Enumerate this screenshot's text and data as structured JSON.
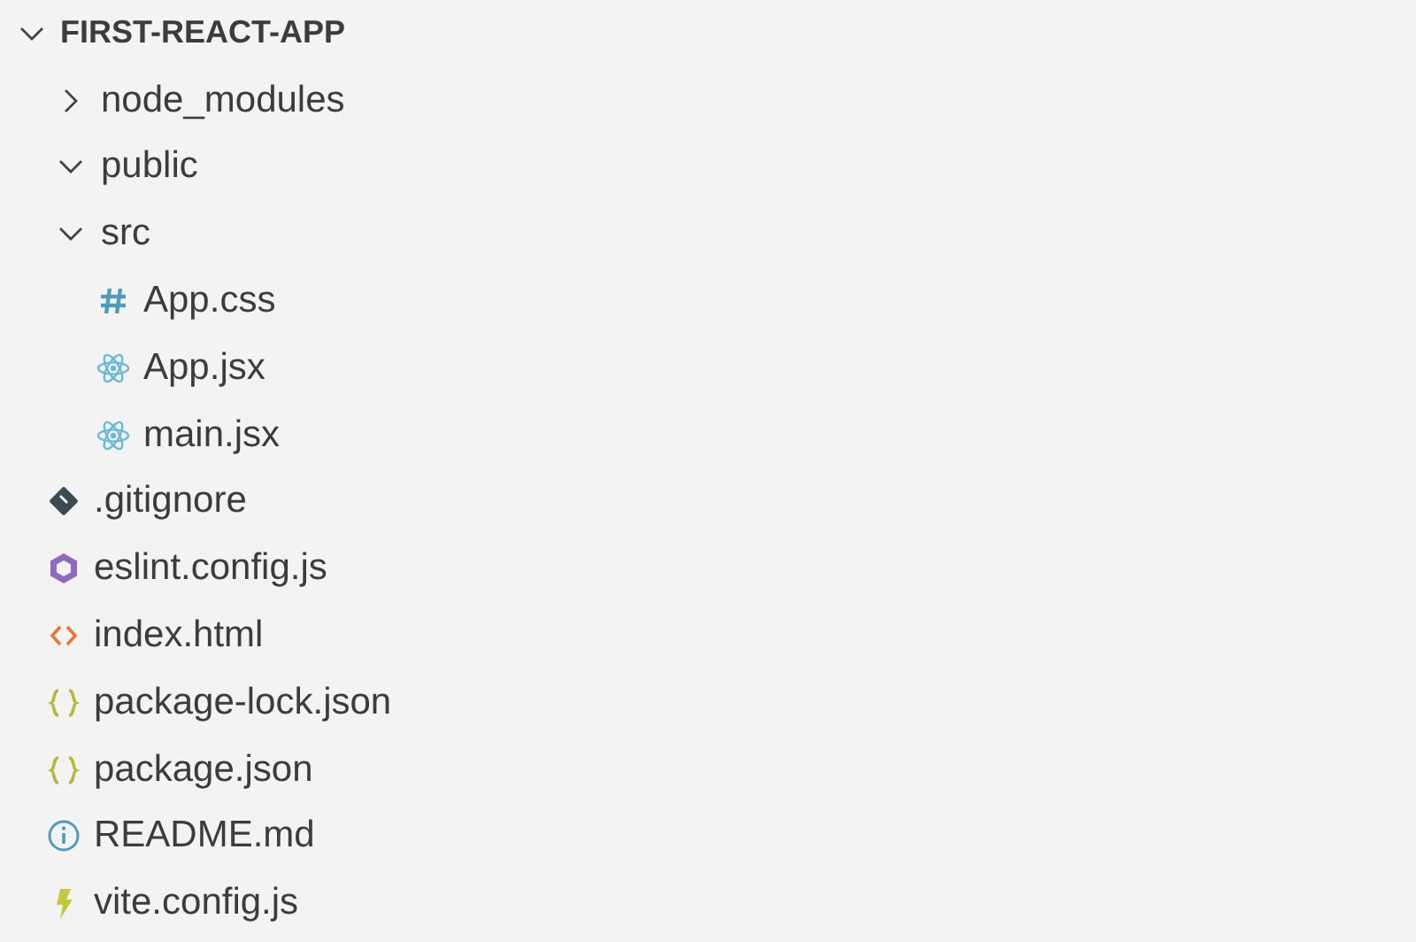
{
  "explorer": {
    "root": {
      "label": "FIRST-REACT-APP",
      "kind": "folder",
      "expanded": true,
      "children": [
        {
          "label": "node_modules",
          "kind": "folder",
          "expanded": false
        },
        {
          "label": "public",
          "kind": "folder",
          "expanded": true
        },
        {
          "label": "src",
          "kind": "folder",
          "expanded": true,
          "children": [
            {
              "label": "App.css",
              "kind": "css"
            },
            {
              "label": "App.jsx",
              "kind": "react"
            },
            {
              "label": "main.jsx",
              "kind": "react"
            }
          ]
        },
        {
          "label": ".gitignore",
          "kind": "git"
        },
        {
          "label": "eslint.config.js",
          "kind": "eslint"
        },
        {
          "label": "index.html",
          "kind": "html"
        },
        {
          "label": "package-lock.json",
          "kind": "json"
        },
        {
          "label": "package.json",
          "kind": "json"
        },
        {
          "label": "README.md",
          "kind": "info"
        },
        {
          "label": "vite.config.js",
          "kind": "vite"
        }
      ]
    }
  }
}
